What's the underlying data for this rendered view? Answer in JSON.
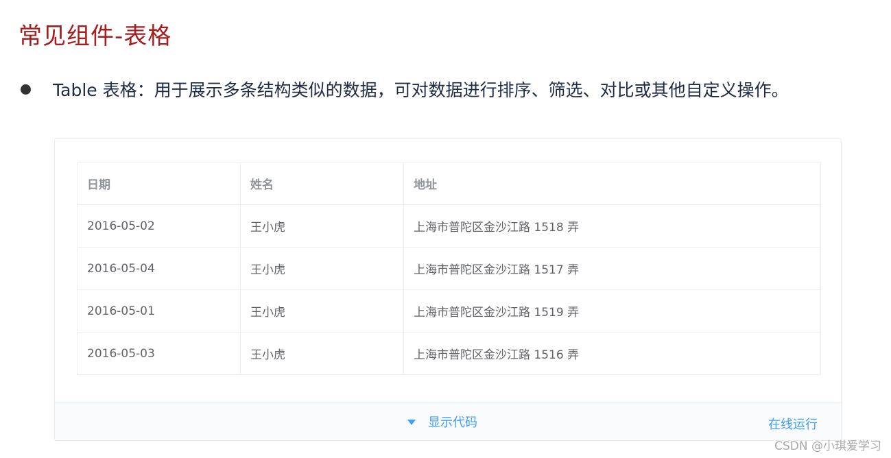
{
  "heading": {
    "title": "常见组件-表格"
  },
  "intro": {
    "text": "Table 表格：用于展示多条结构类似的数据，可对数据进行排序、筛选、对比或其他自定义操作。"
  },
  "table": {
    "columns": [
      "日期",
      "姓名",
      "地址"
    ],
    "rows": [
      {
        "date": "2016-05-02",
        "name": "王小虎",
        "address": "上海市普陀区金沙江路 1518 弄"
      },
      {
        "date": "2016-05-04",
        "name": "王小虎",
        "address": "上海市普陀区金沙江路 1517 弄"
      },
      {
        "date": "2016-05-01",
        "name": "王小虎",
        "address": "上海市普陀区金沙江路 1519 弄"
      },
      {
        "date": "2016-05-03",
        "name": "王小虎",
        "address": "上海市普陀区金沙江路 1516 弄"
      }
    ]
  },
  "footer": {
    "show_code_label": "显示代码",
    "run_online_label": "在线运行"
  },
  "watermark": {
    "text": "CSDN @小琪爱学习"
  },
  "colors": {
    "title": "#a51d1d",
    "link": "#409eff",
    "header_text": "#909399",
    "cell_text": "#606266",
    "border": "#ebeef5"
  },
  "icons": {
    "bullet": "bullet-dot-icon",
    "toggle": "caret-down-icon"
  }
}
